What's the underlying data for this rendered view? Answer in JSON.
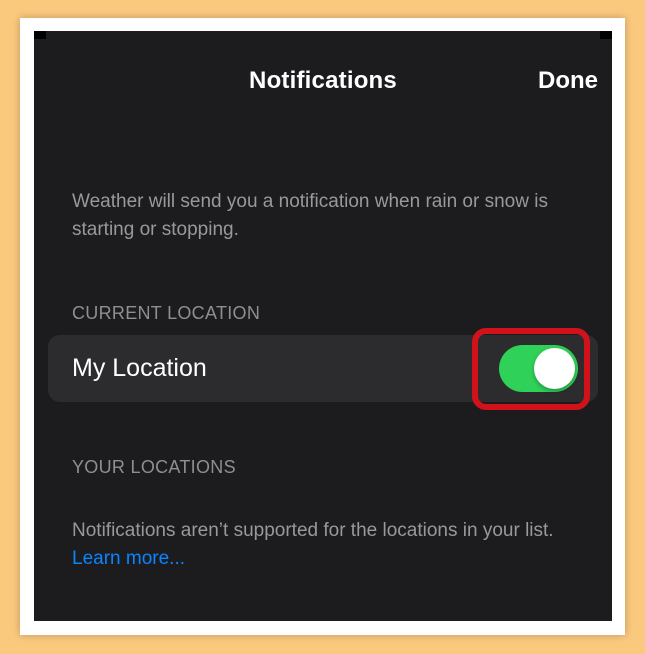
{
  "header": {
    "title": "Notifications",
    "done_label": "Done"
  },
  "intro_text": "Weather will send you a notification when rain or snow is starting or stopping.",
  "current_location": {
    "section_title": "CURRENT LOCATION",
    "row_label": "My Location",
    "toggle_on": true
  },
  "your_locations": {
    "section_title": "YOUR LOCATIONS",
    "note_text": "Notifications aren’t supported for the locations in your list. ",
    "link_label": "Learn more..."
  },
  "colors": {
    "toggle_on": "#30d158",
    "link": "#0a84ff",
    "highlight": "#d1121b",
    "background": "#1c1c1e"
  }
}
